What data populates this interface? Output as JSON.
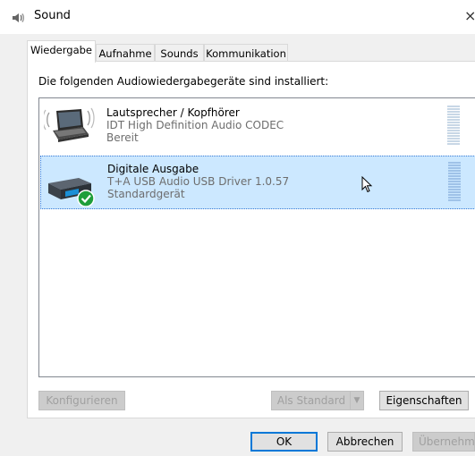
{
  "window": {
    "title": "Sound",
    "close_glyph": "×"
  },
  "tabs": [
    {
      "label": "Wiedergabe",
      "active": true
    },
    {
      "label": "Aufnahme",
      "active": false
    },
    {
      "label": "Sounds",
      "active": false
    },
    {
      "label": "Kommunikation",
      "active": false
    }
  ],
  "panel": {
    "heading": "Die folgenden Audiowiedergabegeräte sind installiert:"
  },
  "devices": [
    {
      "name": "Lautsprecher / Kopfhörer",
      "driver": "IDT High Definition Audio CODEC",
      "status": "Bereit",
      "icon": "laptop-speaker-icon",
      "selected": false,
      "default": false
    },
    {
      "name": "Digitale Ausgabe",
      "driver": "T+A USB Audio USB Driver 1.0.57",
      "status": "Standardgerät",
      "icon": "usb-audio-device-icon",
      "selected": true,
      "default": true
    }
  ],
  "buttons": {
    "configure": "Konfigurieren",
    "set_default": "Als Standard",
    "properties": "Eigenschaften",
    "ok": "OK",
    "cancel": "Abbrechen",
    "apply": "Übernehmen"
  },
  "colors": {
    "selection": "#cce8ff",
    "focus_border": "#0078d7",
    "default_check": "#1e9e3a"
  }
}
